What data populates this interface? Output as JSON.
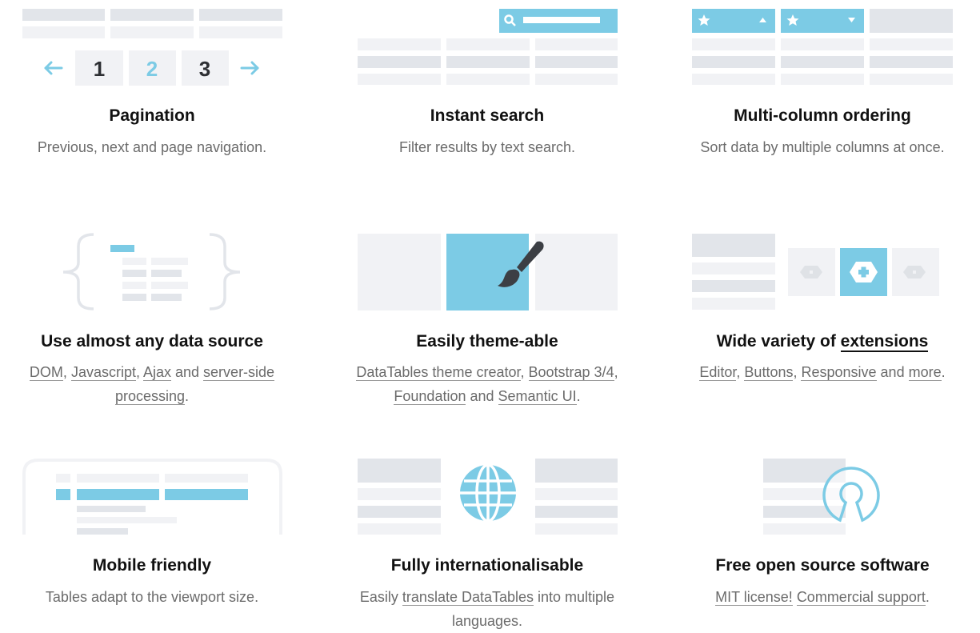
{
  "colors": {
    "accent": "#7ccbe5",
    "light": "#f1f2f5",
    "mid": "#e2e5ea",
    "dark": "#3c3f44"
  },
  "pagination": {
    "title": "Pagination",
    "desc": "Previous, next and page navigation.",
    "pages": [
      "1",
      "2",
      "3"
    ],
    "prev_icon": "arrow-left-icon",
    "next_icon": "arrow-right-icon"
  },
  "search": {
    "title": "Instant search",
    "desc": "Filter results by text search.",
    "icon": "search-icon"
  },
  "ordering": {
    "title": "Multi-column ordering",
    "desc": "Sort data by multiple columns at once.",
    "icons": [
      "star-icon",
      "star-icon"
    ]
  },
  "datasource": {
    "title": "Use almost any data source",
    "links": [
      "DOM",
      "Javascript",
      "Ajax",
      "server-side processing"
    ],
    "sep1": ", ",
    "sep2": " and ",
    "end": "."
  },
  "theme": {
    "title": "Easily theme-able",
    "links": [
      "DataTables theme creator",
      "Bootstrap 3/4",
      "Foundation",
      "Semantic UI"
    ],
    "sep1": ", ",
    "sep2": " and ",
    "end": ".",
    "icon": "paintbrush-icon"
  },
  "extensions": {
    "title_prefix": "Wide variety of ",
    "title_link": "extensions",
    "links": [
      "Editor",
      "Buttons",
      "Responsive",
      "more"
    ],
    "sep1": ", ",
    "sep2": " and ",
    "end": ".",
    "icon": "plus-hexagon-icon"
  },
  "mobile": {
    "title": "Mobile friendly",
    "desc": "Tables adapt to the viewport size."
  },
  "i18n": {
    "title": "Fully internationalisable",
    "prefix": "Easily ",
    "link": "translate DataTables",
    "suffix": " into multiple languages.",
    "icon": "globe-icon"
  },
  "opensource": {
    "title": "Free open source software",
    "links": [
      "MIT license!",
      "Commercial support"
    ],
    "sep": " ",
    "end": ".",
    "icon": "open-source-icon"
  }
}
